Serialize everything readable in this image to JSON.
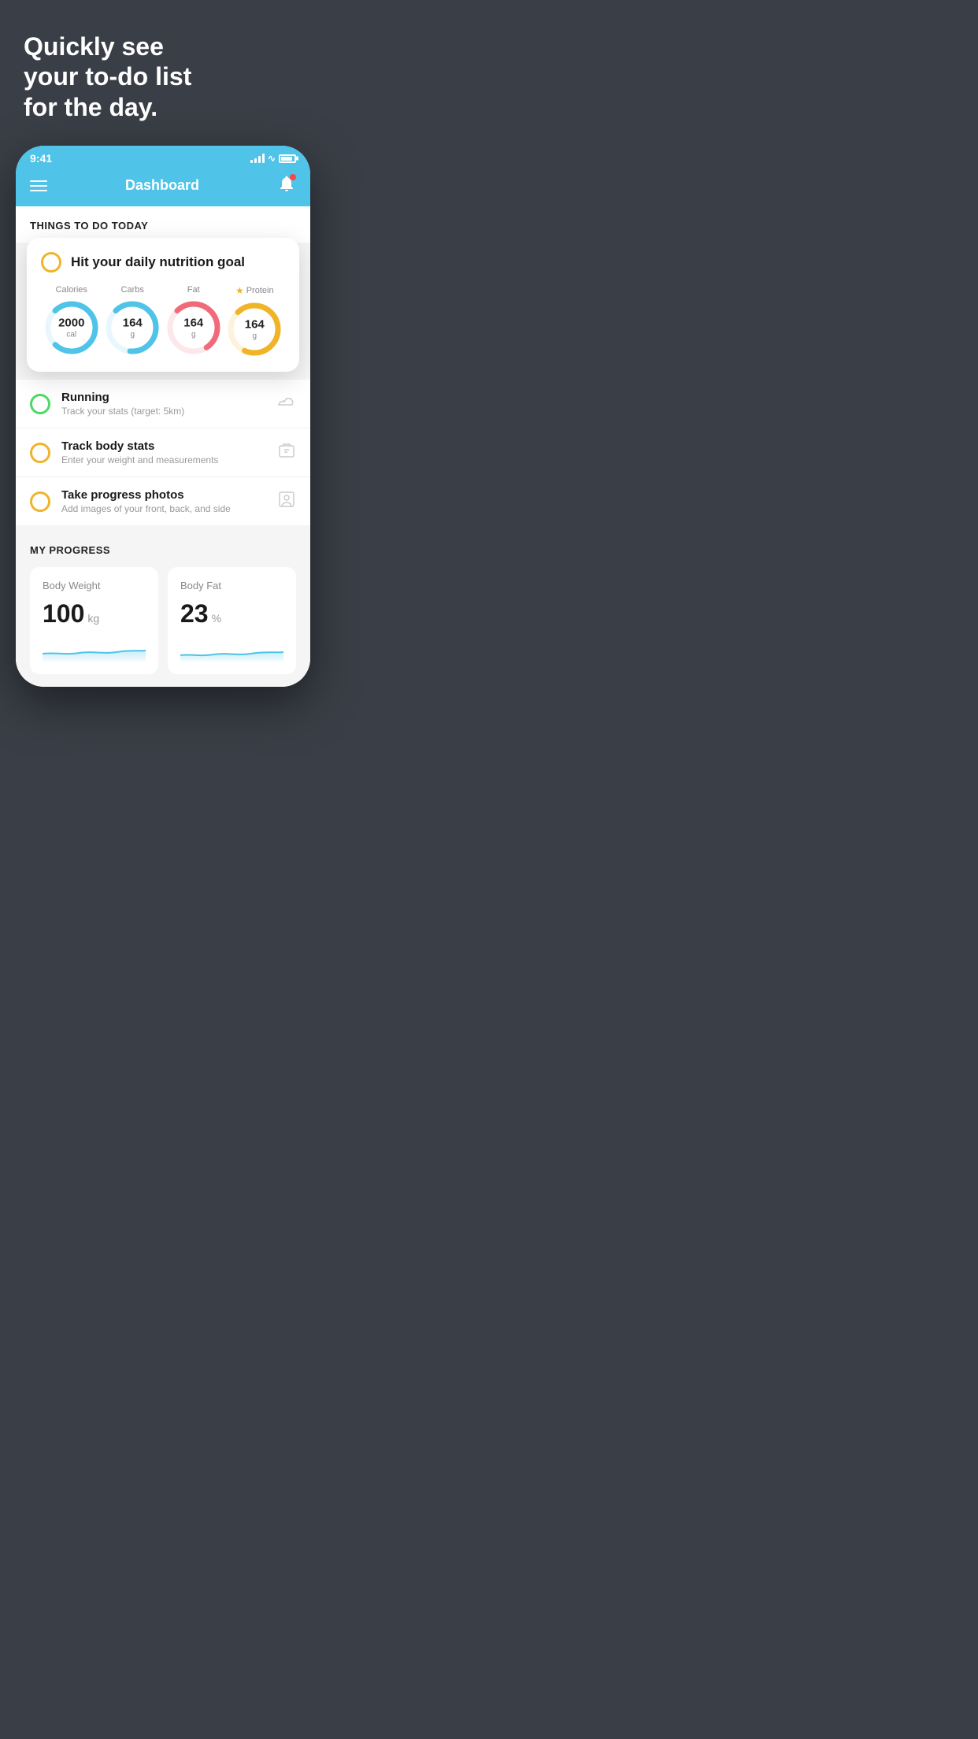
{
  "page": {
    "background_color": "#3a3f47",
    "headline_line1": "Quickly see",
    "headline_line2": "your to-do list",
    "headline_line3": "for the day."
  },
  "status_bar": {
    "time": "9:41",
    "background": "#4fc3e8"
  },
  "nav": {
    "title": "Dashboard",
    "background": "#4fc3e8"
  },
  "things_section": {
    "title": "THINGS TO DO TODAY"
  },
  "nutrition_card": {
    "title": "Hit your daily nutrition goal",
    "calories": {
      "label": "Calories",
      "value": "2000",
      "unit": "cal",
      "color": "#4fc3e8"
    },
    "carbs": {
      "label": "Carbs",
      "value": "164",
      "unit": "g",
      "color": "#4fc3e8"
    },
    "fat": {
      "label": "Fat",
      "value": "164",
      "unit": "g",
      "color": "#f06b7a"
    },
    "protein": {
      "label": "Protein",
      "value": "164",
      "unit": "g",
      "color": "#f0b429"
    }
  },
  "todo_items": [
    {
      "name": "Running",
      "sub": "Track your stats (target: 5km)",
      "circle_type": "green",
      "icon": "shoe"
    },
    {
      "name": "Track body stats",
      "sub": "Enter your weight and measurements",
      "circle_type": "yellow",
      "icon": "scale"
    },
    {
      "name": "Take progress photos",
      "sub": "Add images of your front, back, and side",
      "circle_type": "yellow",
      "icon": "person"
    }
  ],
  "progress_section": {
    "title": "MY PROGRESS",
    "body_weight": {
      "label": "Body Weight",
      "value": "100",
      "unit": "kg"
    },
    "body_fat": {
      "label": "Body Fat",
      "value": "23",
      "unit": "%"
    }
  }
}
